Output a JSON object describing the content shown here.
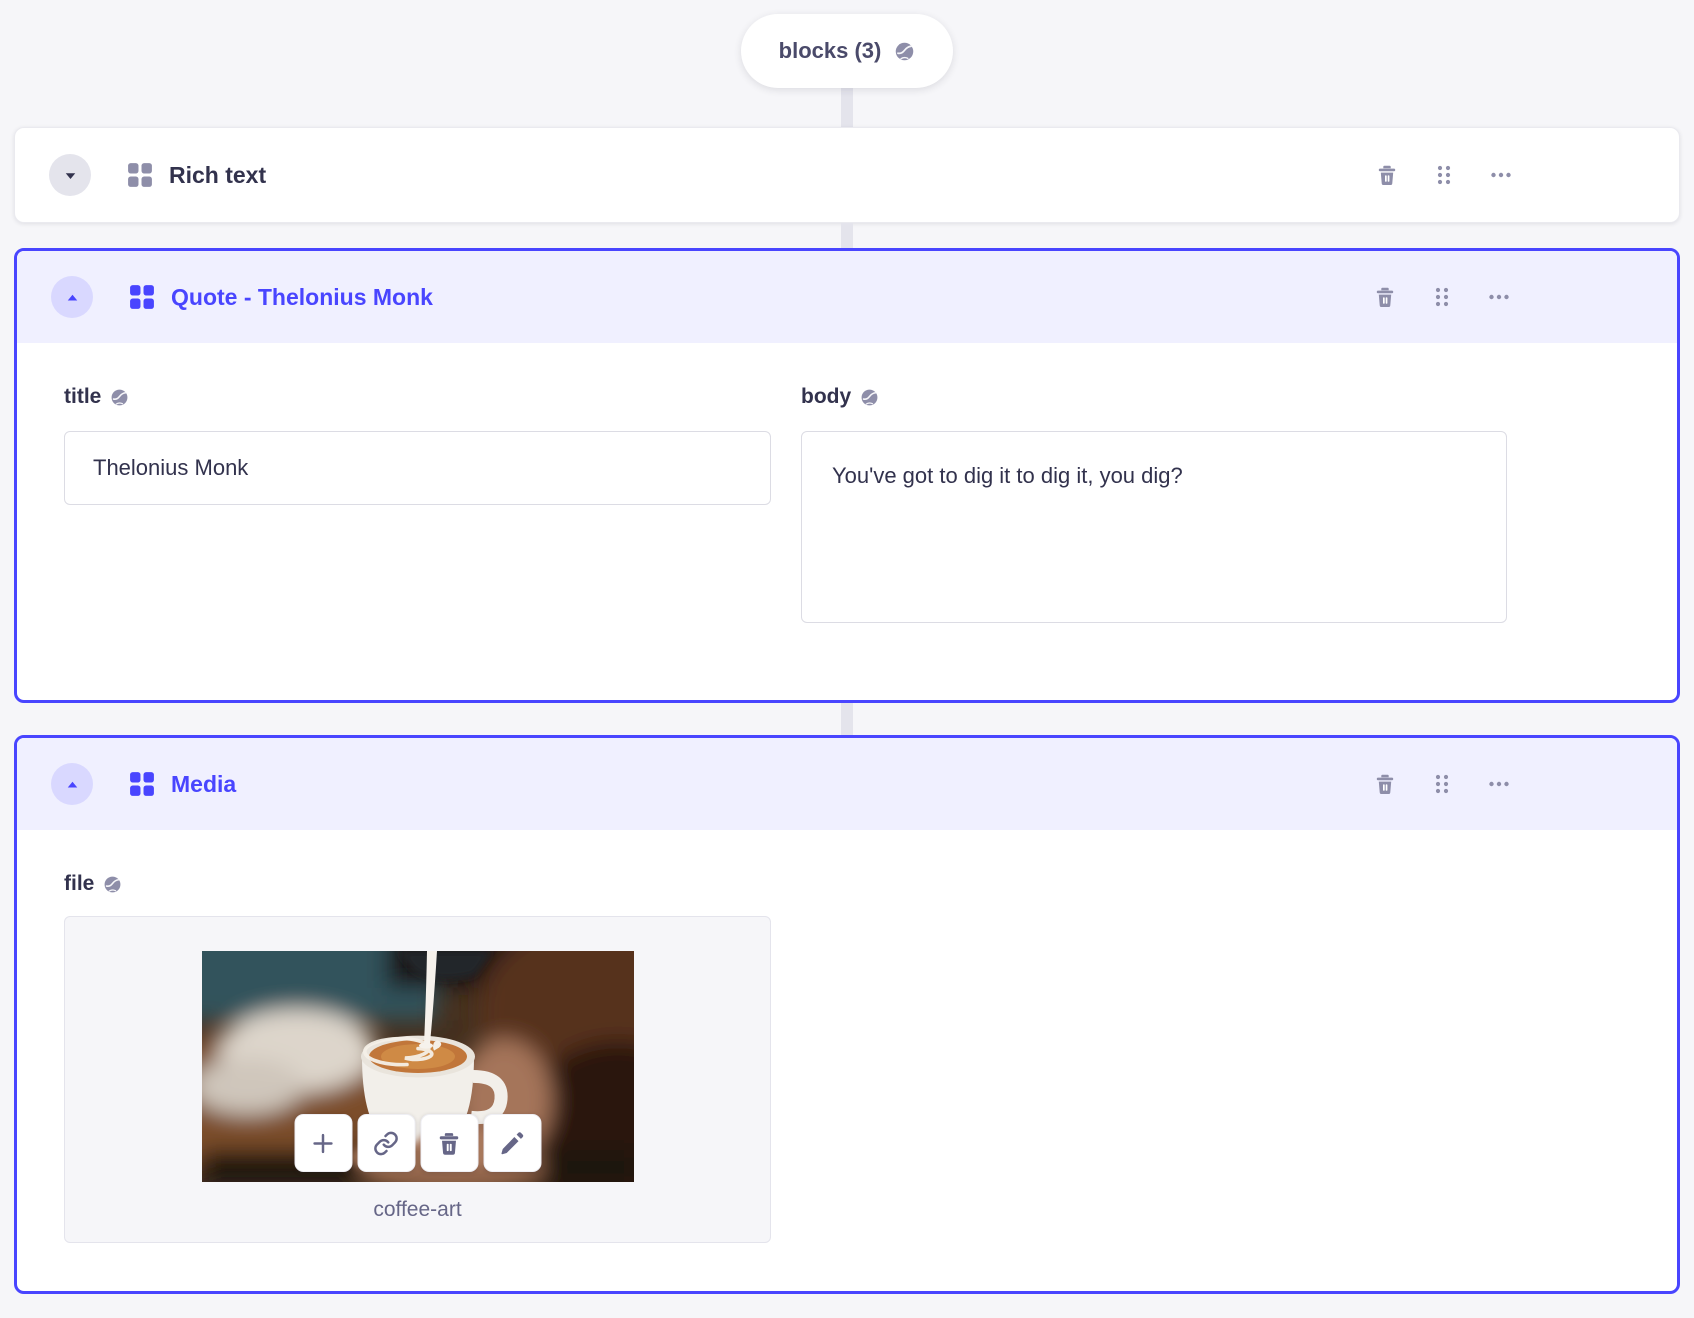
{
  "colors": {
    "primary": "#4945ff",
    "primary_header_bg": "#f0f0ff",
    "page_bg": "#f6f6f9",
    "neutral_icon": "#8e8ea9",
    "dark_text": "#32324d",
    "muted_text": "#666687"
  },
  "zone_pill": {
    "label": "blocks (3)",
    "icon": "globe-icon"
  },
  "blocks": [
    {
      "title": "Rich text",
      "state": "collapsed"
    },
    {
      "title": "Quote - Thelonius Monk",
      "state": "expanded"
    },
    {
      "title": "Media",
      "state": "expanded"
    }
  ],
  "block_actions": [
    "delete",
    "drag",
    "more-options"
  ],
  "quote_fields": {
    "title": {
      "label": "title",
      "value": "Thelonius Monk"
    },
    "body": {
      "label": "body",
      "value": "You've got to dig it to dig it, you dig?"
    }
  },
  "media_fields": {
    "file": {
      "label": "file",
      "filename": "coffee-art"
    }
  },
  "media_toolbar": [
    "add",
    "copy-link",
    "delete",
    "edit"
  ],
  "icons": {
    "globe-icon": "localized field globe",
    "component-grid-icon": "2x2 component squares",
    "trash-icon": "delete bin",
    "drag-handle-icon": "six dots drag grip",
    "more-options-icon": "horizontal ellipsis",
    "chevron-down-icon": "collapsed accordion arrow",
    "chevron-up-icon": "expanded accordion arrow",
    "plus-icon": "add media",
    "link-icon": "copy link chain",
    "pencil-icon": "edit"
  }
}
